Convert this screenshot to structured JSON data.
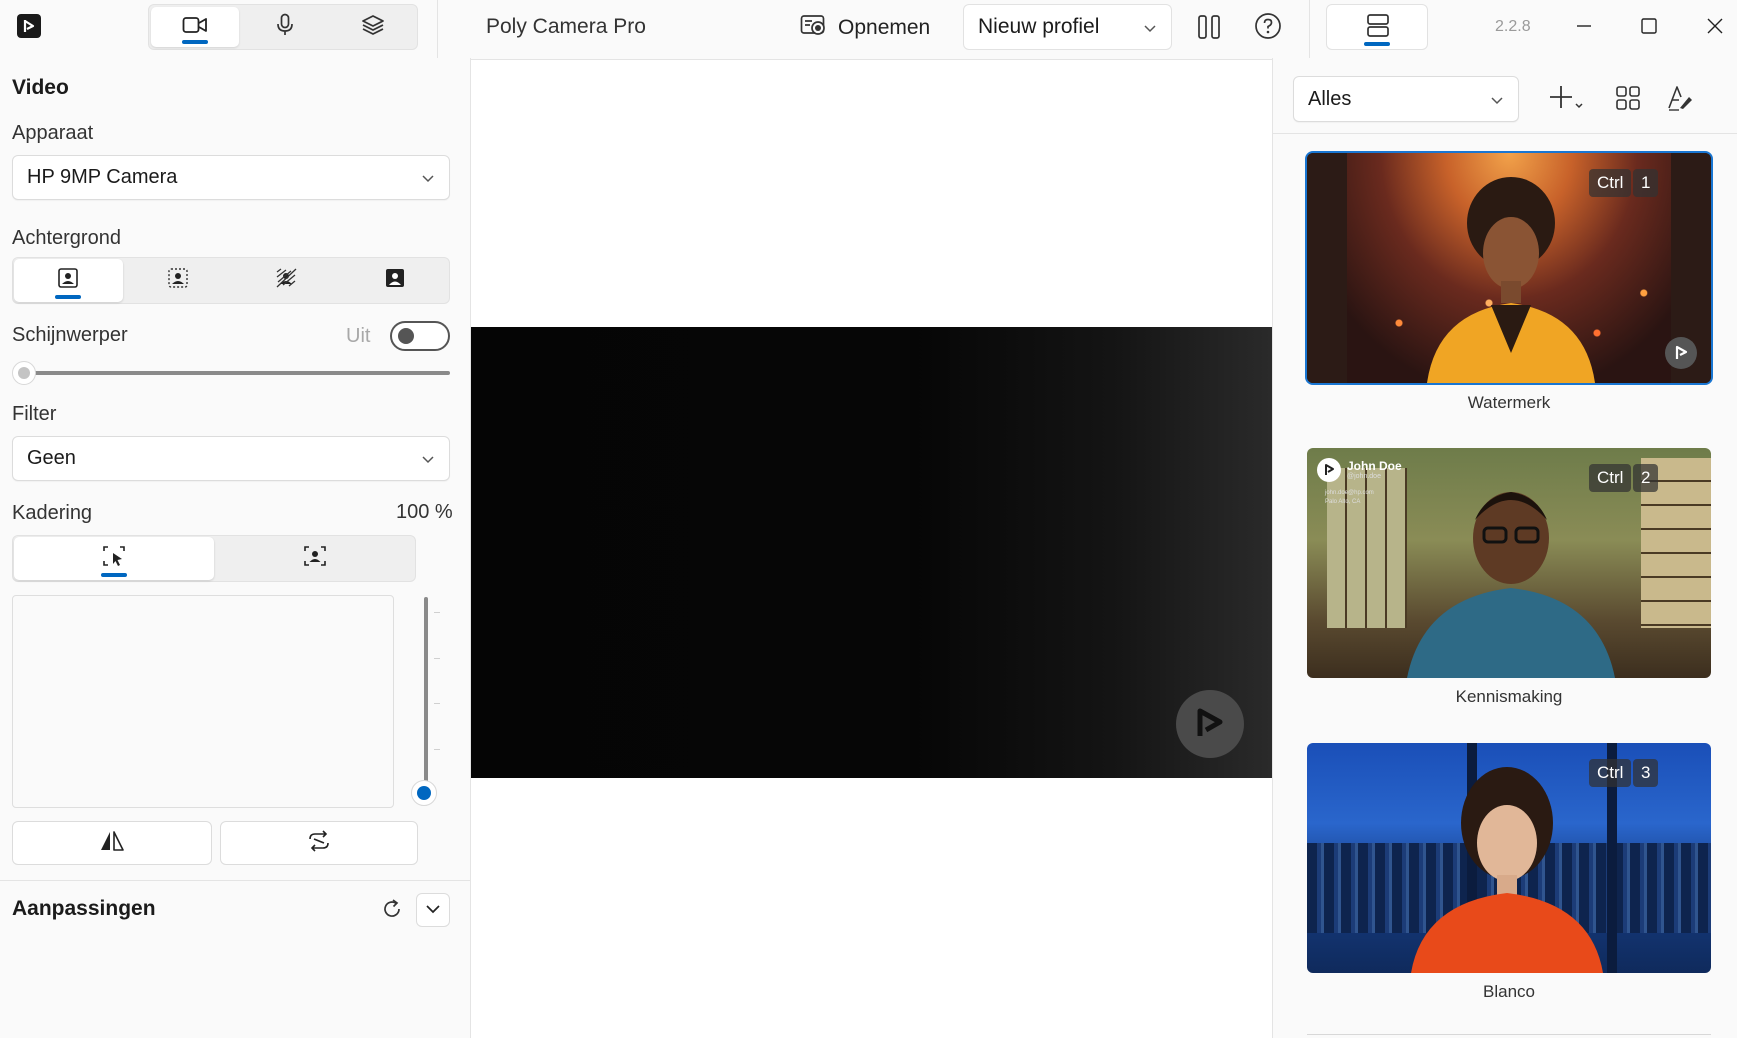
{
  "titlebar": {
    "app_title": "Poly Camera Pro",
    "record_label": "Opnemen",
    "profile_value": "Nieuw profiel",
    "version": "2.2.8",
    "tabs": [
      "video-camera-icon",
      "microphone-icon",
      "layers-icon"
    ]
  },
  "left": {
    "section_video": "Video",
    "device_label": "Apparaat",
    "device_value": "HP 9MP Camera",
    "background_label": "Achtergrond",
    "spotlight_label": "Schijnwerper",
    "spotlight_state": "Uit",
    "spotlight_on": false,
    "spotlight_level": 0,
    "filter_label": "Filter",
    "filter_value": "Geen",
    "framing_label": "Kadering",
    "framing_value": "100 %",
    "zoom_level": 0,
    "adjustments_label": "Aanpassingen"
  },
  "right": {
    "filter_value": "Alles",
    "cards": [
      {
        "label": "Watermerk",
        "modifier": "Ctrl",
        "key": "1"
      },
      {
        "label": "Kennismaking",
        "modifier": "Ctrl",
        "key": "2"
      },
      {
        "label": "Blanco",
        "modifier": "Ctrl",
        "key": "3"
      }
    ],
    "overlay_name": "John Doe",
    "overlay_handle": "@john.doe",
    "overlay_email": "john.doe@hp.com",
    "overlay_location": "Palo Alto, CA"
  },
  "colors": {
    "accent": "#0067c0",
    "selection": "#1976d2"
  }
}
